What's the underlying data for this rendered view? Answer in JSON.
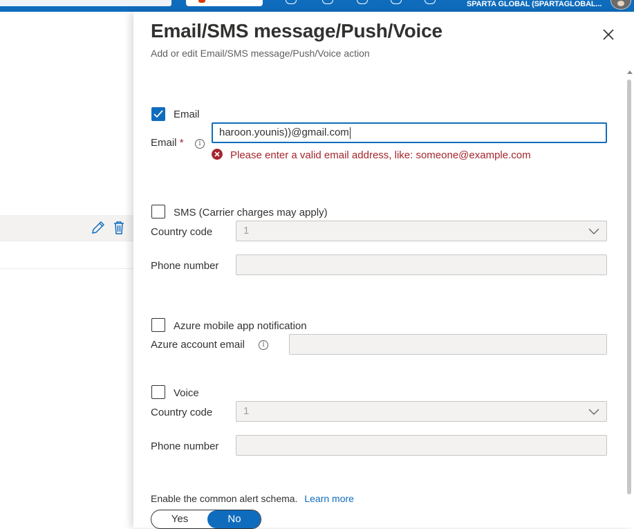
{
  "topbar": {
    "tenant": "SPARTA GLOBAL (SPARTAGLOBAL..."
  },
  "panel": {
    "title": "Email/SMS message/Push/Voice",
    "subtitle": "Add or edit Email/SMS message/Push/Voice action"
  },
  "email": {
    "checkbox_label": "Email",
    "checked": true,
    "field_label": "Email",
    "required_mark": "*",
    "value": "haroon.younis))@gmail.com",
    "error": "Please enter a valid email address, like: someone@example.com"
  },
  "sms": {
    "checkbox_label": "SMS (Carrier charges may apply)",
    "checked": false,
    "country_label": "Country code",
    "country_value": "1",
    "phone_label": "Phone number",
    "phone_value": ""
  },
  "azure_app": {
    "checkbox_label": "Azure mobile app notification",
    "checked": false,
    "email_label": "Azure account email",
    "email_value": ""
  },
  "voice": {
    "checkbox_label": "Voice",
    "checked": false,
    "country_label": "Country code",
    "country_value": "1",
    "phone_label": "Phone number",
    "phone_value": ""
  },
  "schema": {
    "label": "Enable the common alert schema.",
    "link": "Learn more",
    "options": [
      "Yes",
      "No"
    ],
    "selected": "No"
  },
  "icons": {
    "close": "close-icon",
    "info": "info-icon",
    "chevron": "chevron-down-icon",
    "edit": "pencil-icon",
    "delete": "trash-icon",
    "error": "error-circle-icon"
  },
  "colors": {
    "accent": "#0f6cbd",
    "error": "#a4262c",
    "text": "#323130"
  }
}
